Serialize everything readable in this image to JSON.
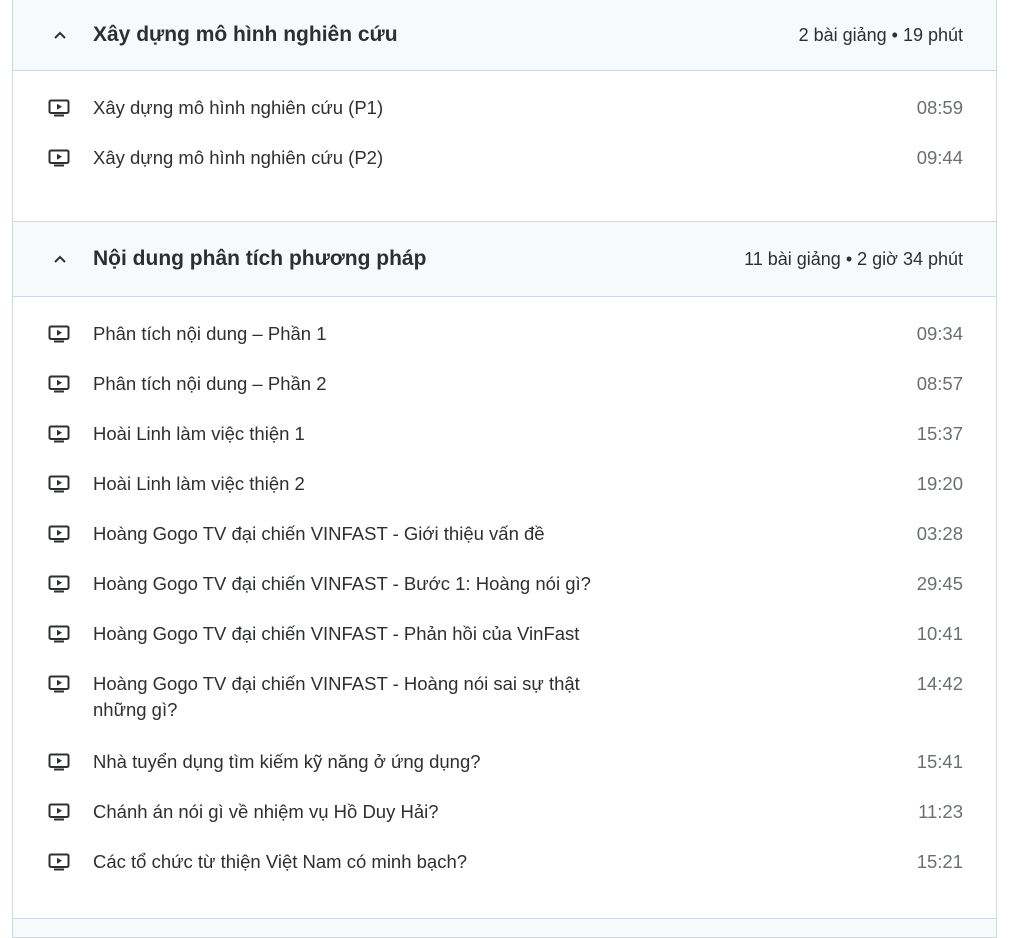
{
  "sections": [
    {
      "title": "Xây dựng mô hình nghiên cứu",
      "meta": "2 bài giảng • 19 phút",
      "lectures": [
        {
          "title": "Xây dựng mô hình nghiên cứu (P1)",
          "duration": "08:59"
        },
        {
          "title": "Xây dựng mô hình nghiên cứu (P2)",
          "duration": "09:44"
        }
      ]
    },
    {
      "title": "Nội dung phân tích phương pháp",
      "meta": "11 bài giảng • 2 giờ 34 phút",
      "lectures": [
        {
          "title": "Phân tích nội dung – Phần 1",
          "duration": "09:34"
        },
        {
          "title": "Phân tích nội dung – Phần 2",
          "duration": "08:57"
        },
        {
          "title": "Hoài Linh làm việc thiện 1",
          "duration": "15:37"
        },
        {
          "title": "Hoài Linh làm việc thiện 2",
          "duration": "19:20"
        },
        {
          "title": "Hoàng Gogo TV đại chiến VINFAST - Giới thiệu vấn đề",
          "duration": "03:28"
        },
        {
          "title": "Hoàng Gogo TV đại chiến VINFAST - Bước 1: Hoàng nói gì?",
          "duration": "29:45"
        },
        {
          "title": "Hoàng Gogo TV đại chiến VINFAST - Phản hồi của VinFast",
          "duration": "10:41"
        },
        {
          "title": "Hoàng Gogo TV đại chiến VINFAST - Hoàng nói sai sự thật những gì?",
          "duration": "14:42"
        },
        {
          "title": "Nhà tuyển dụng tìm kiếm kỹ năng ở ứng dụng?",
          "duration": "15:41"
        },
        {
          "title": "Chánh án nói gì về nhiệm vụ Hồ Duy Hải?",
          "duration": "11:23"
        },
        {
          "title": "Các tổ chức từ thiện Việt Nam có minh bạch?",
          "duration": "15:21"
        }
      ]
    }
  ],
  "icons": {
    "collapse": "chevron-up-icon",
    "lecture": "video-icon"
  },
  "colors": {
    "header_bg": "#f7f9fa",
    "border": "#d1d7dc",
    "text": "#2d2f31",
    "muted": "#6a6f73"
  }
}
